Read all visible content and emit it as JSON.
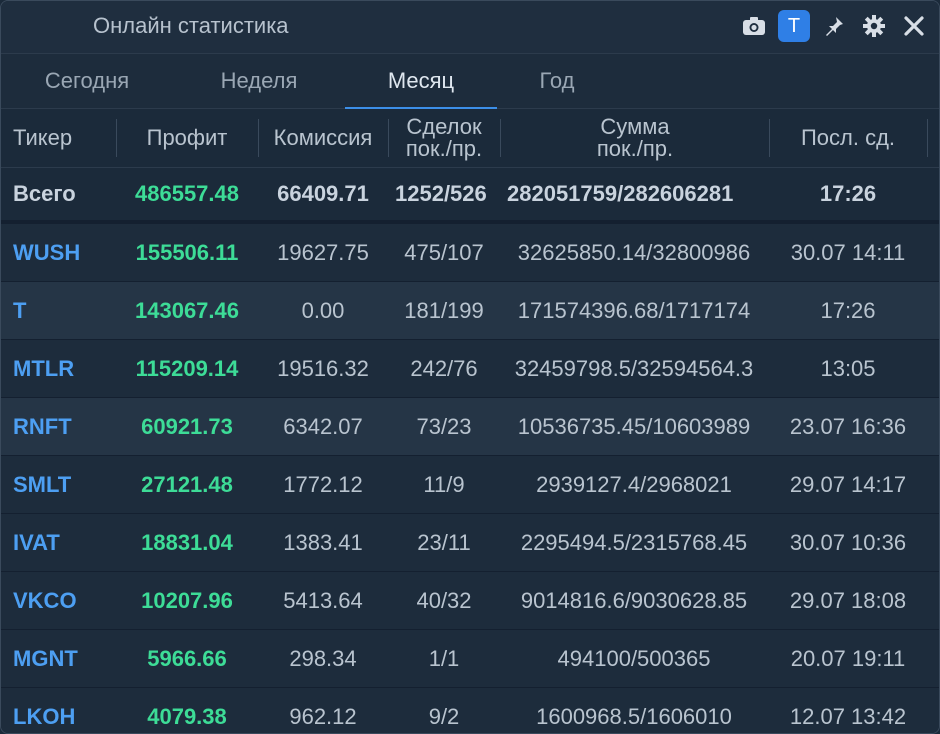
{
  "window": {
    "title": "Онлайн статистика"
  },
  "toolbar": {
    "icons": [
      "camera-icon",
      "t-badge",
      "pin-icon",
      "gear-icon",
      "close-icon"
    ],
    "t_label": "T"
  },
  "tabs": [
    {
      "label": "Сегодня"
    },
    {
      "label": "Неделя"
    },
    {
      "label": "Месяц",
      "active": true
    },
    {
      "label": "Год"
    }
  ],
  "columns": {
    "ticker": "Тикер",
    "profit": "Профит",
    "commission": "Комиссия",
    "trades_l1": "Сделок",
    "trades_l2": "пок./пр.",
    "sum_l1": "Сумма",
    "sum_l2": "пок./пр.",
    "last": "Посл. сд."
  },
  "total": {
    "ticker": "Всего",
    "profit": "486557.48",
    "commission": "66409.71",
    "trades": "1252/526",
    "sum": "282051759/282606281",
    "last": "17:26"
  },
  "rows": [
    {
      "ticker": "WUSH",
      "profit": "155506.11",
      "commission": "19627.75",
      "trades": "475/107",
      "sum": "32625850.14/32800986",
      "last": "30.07 14:11"
    },
    {
      "ticker": "T",
      "profit": "143067.46",
      "commission": "0.00",
      "trades": "181/199",
      "sum": "171574396.68/1717174",
      "last": "17:26"
    },
    {
      "ticker": "MTLR",
      "profit": "115209.14",
      "commission": "19516.32",
      "trades": "242/76",
      "sum": "32459798.5/32594564.3",
      "last": "13:05"
    },
    {
      "ticker": "RNFT",
      "profit": "60921.73",
      "commission": "6342.07",
      "trades": "73/23",
      "sum": "10536735.45/10603989",
      "last": "23.07 16:36"
    },
    {
      "ticker": "SMLT",
      "profit": "27121.48",
      "commission": "1772.12",
      "trades": "11/9",
      "sum": "2939127.4/2968021",
      "last": "29.07 14:17"
    },
    {
      "ticker": "IVAT",
      "profit": "18831.04",
      "commission": "1383.41",
      "trades": "23/11",
      "sum": "2295494.5/2315768.45",
      "last": "30.07 10:36"
    },
    {
      "ticker": "VKCO",
      "profit": "10207.96",
      "commission": "5413.64",
      "trades": "40/32",
      "sum": "9014816.6/9030628.85",
      "last": "29.07 18:08"
    },
    {
      "ticker": "MGNT",
      "profit": "5966.66",
      "commission": "298.34",
      "trades": "1/1",
      "sum": "494100/500365",
      "last": "20.07 19:11"
    },
    {
      "ticker": "LKOH",
      "profit": "4079.38",
      "commission": "962.12",
      "trades": "9/2",
      "sum": "1600968.5/1606010",
      "last": "12.07 13:42"
    }
  ],
  "colors": {
    "background": "#1d2c3c",
    "accent": "#2f7fe6",
    "ticker": "#4d9ff2",
    "profit": "#3ddc97",
    "row_alt": "#253546"
  }
}
